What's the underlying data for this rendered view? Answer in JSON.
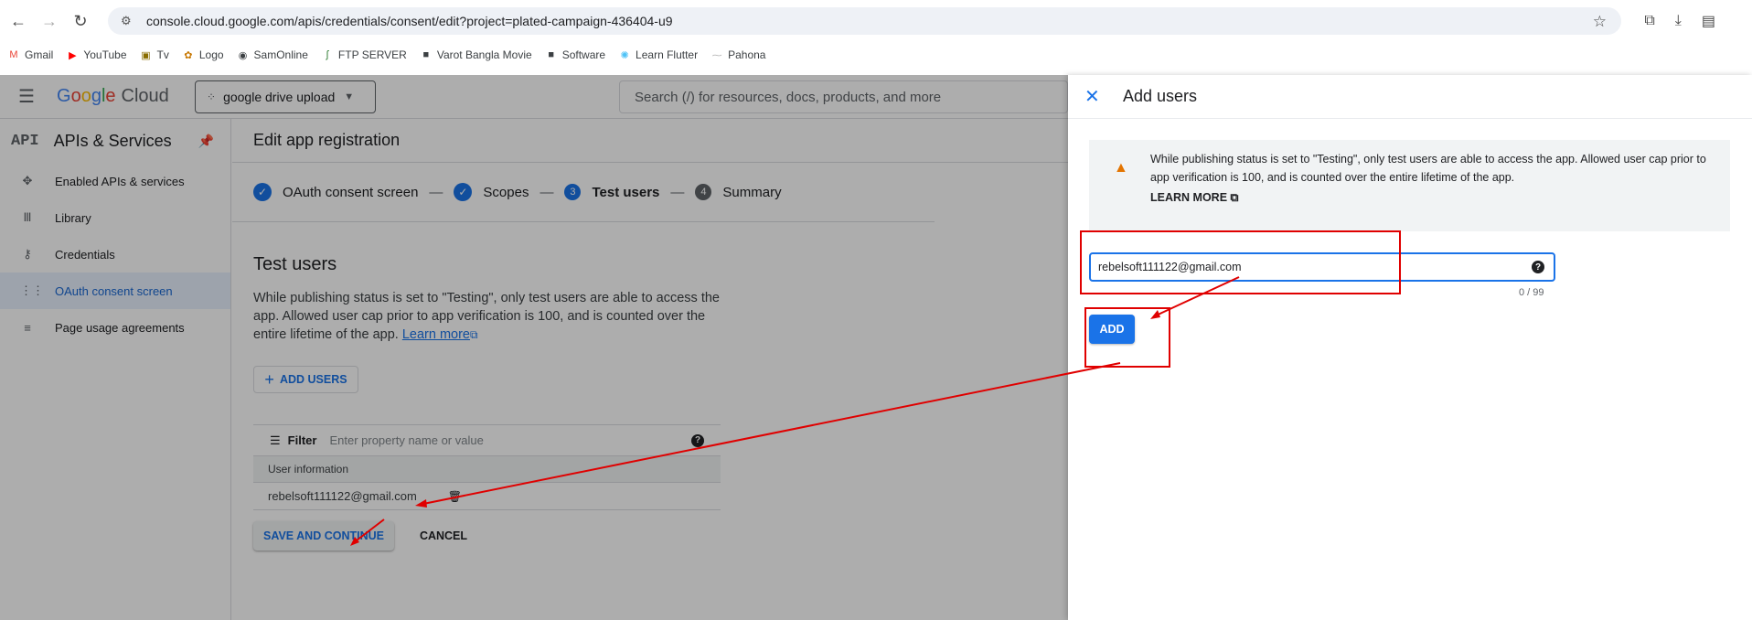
{
  "browser": {
    "url": "console.cloud.google.com/apis/credentials/consent/edit?project=plated-campaign-436404-u9",
    "bookmarks": [
      "Gmail",
      "YouTube",
      "Tv",
      "Logo",
      "SamOnline",
      "FTP SERVER",
      "Varot Bangla Movie",
      "Software",
      "Learn Flutter",
      "Pahona"
    ]
  },
  "header": {
    "logo_google": "Google",
    "logo_cloud": "Cloud",
    "project": "google drive upload",
    "search_placeholder": "Search (/) for resources, docs, products, and more"
  },
  "sidebar": {
    "title": "APIs & Services",
    "api_badge": "API",
    "items": [
      {
        "label": "Enabled APIs & services",
        "icon": "enabled-apis-icon"
      },
      {
        "label": "Library",
        "icon": "library-icon"
      },
      {
        "label": "Credentials",
        "icon": "key-icon"
      },
      {
        "label": "OAuth consent screen",
        "icon": "oauth-icon",
        "active": true
      },
      {
        "label": "Page usage agreements",
        "icon": "settings-list-icon"
      }
    ]
  },
  "main": {
    "title": "Edit app registration",
    "steps": [
      {
        "label": "OAuth consent screen",
        "state": "done"
      },
      {
        "label": "Scopes",
        "state": "done"
      },
      {
        "num": "3",
        "label": "Test users",
        "state": "current"
      },
      {
        "num": "4",
        "label": "Summary",
        "state": "todo"
      }
    ],
    "section_title": "Test users",
    "section_desc": "While publishing status is set to \"Testing\", only test users are able to access the app. Allowed user cap prior to app verification is 100, and is counted over the entire lifetime of the app.",
    "learn_more": "Learn more",
    "add_users": "ADD USERS",
    "filter_label": "Filter",
    "filter_placeholder": "Enter property name or value",
    "column_header": "User information",
    "rows": [
      "rebelsoft111122@gmail.com"
    ],
    "save_continue": "SAVE AND CONTINUE",
    "cancel": "CANCEL"
  },
  "panel": {
    "title": "Add users",
    "alert_text": "While publishing status is set to \"Testing\", only test users are able to access the app. Allowed user cap prior to app verification is 100, and is counted over the entire lifetime of the app.",
    "learn_more": "LEARN MORE",
    "email_value": "rebelsoft111122@gmail.com",
    "counter": "0 / 99",
    "add": "ADD"
  },
  "colors": {
    "accent": "#1a73e8",
    "annotation": "#e00000",
    "warning": "#e37400"
  }
}
